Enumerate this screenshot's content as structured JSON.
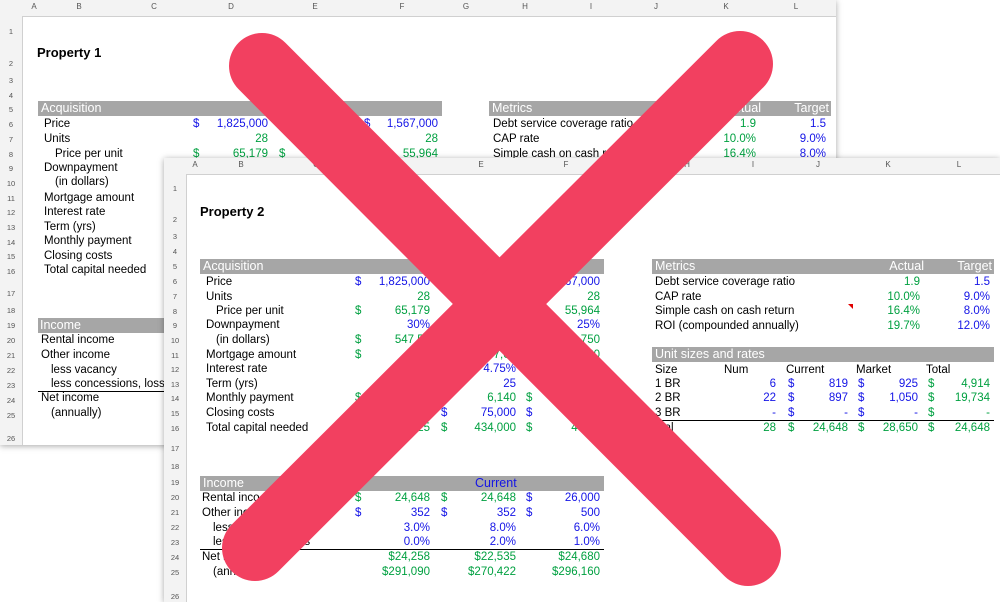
{
  "sheet1": {
    "cols": [
      "A",
      "B",
      "C",
      "D",
      "E",
      "F",
      "G",
      "H",
      "I",
      "J",
      "K",
      "L"
    ],
    "rows": [
      "1",
      "2",
      "3",
      "4",
      "5",
      "6",
      "7",
      "8",
      "9",
      "10",
      "11",
      "12",
      "13",
      "14",
      "15",
      "16",
      "17",
      "18",
      "19",
      "20",
      "21",
      "22",
      "23",
      "24",
      "25",
      "26"
    ],
    "title": "Property 1",
    "acq_header": "Acquisition",
    "acq_labels": [
      "Price",
      "Units",
      "Price per unit",
      "Downpayment",
      "(in dollars)",
      "Mortgage amount",
      "Interest rate",
      "Term (yrs)",
      "Monthly payment",
      "Closing costs",
      "Total capital needed"
    ],
    "price_d": "1,825,000",
    "price_f": "1,567,000",
    "units_d": "28",
    "units_f": "28",
    "ppu_d": "65,179",
    "ppu_f": "55,964",
    "dollar": "$",
    "metrics_header": "Metrics",
    "metrics_actual": "Actual",
    "metrics_target": "Target",
    "metrics": [
      {
        "label": "Debt service coverage ratio",
        "actual": "1.9",
        "target": "1.5"
      },
      {
        "label": "CAP rate",
        "actual": "10.0%",
        "target": "9.0%"
      },
      {
        "label": "Simple cash on cash re",
        "actual": "16.4%",
        "target": "8.0%"
      }
    ],
    "income_header": "Income",
    "income_labels": [
      "Rental income",
      "Other income",
      "less vacancy",
      "less concessions, loss",
      "Net income",
      "(annually)"
    ]
  },
  "sheet2": {
    "cols": [
      "A",
      "B",
      "C",
      "D",
      "E",
      "F",
      "G",
      "H",
      "I",
      "J",
      "K",
      "L"
    ],
    "rows": [
      "1",
      "2",
      "3",
      "4",
      "5",
      "6",
      "7",
      "8",
      "9",
      "10",
      "11",
      "12",
      "13",
      "14",
      "15",
      "16",
      "17",
      "18",
      "19",
      "20",
      "21",
      "22",
      "23",
      "24",
      "25",
      "26"
    ],
    "title": "Property 2",
    "acq_header": "Acquisition",
    "acq": [
      {
        "label": "Price",
        "d": "1,825,000",
        "e": "",
        "f": "1,567,000"
      },
      {
        "label": "Units",
        "d": "28",
        "e": "",
        "f": "28"
      },
      {
        "label": "Price per unit",
        "d": "65,179",
        "e": "",
        "f": "55,964"
      },
      {
        "label": "Downpayment",
        "d": "30%",
        "e": "",
        "f": "25%"
      },
      {
        "label": "(in dollars)",
        "d": "547,50",
        "e": "",
        "f": "1,750"
      },
      {
        "label": "Mortgage amount",
        "d": "1,27",
        "e": "377,00",
        "f": "60"
      },
      {
        "label": "Interest rate",
        "d": "",
        "e": "4.75%",
        "f": ""
      },
      {
        "label": "Term (yrs)",
        "d": "",
        "e": "25",
        "f": ""
      },
      {
        "label": "Monthly payment",
        "d": "",
        "e": "6,140",
        "f": ""
      },
      {
        "label": "Closing costs",
        "d": "25",
        "e": "75,000",
        "f": "7"
      },
      {
        "label": "Total capital needed",
        "d": "2,825",
        "e": "434,000",
        "f": "466,7"
      }
    ],
    "dollar": "$",
    "metrics_header": "Metrics",
    "metrics_actual": "Actual",
    "metrics_target": "Target",
    "metrics": [
      {
        "label": "Debt service coverage ratio",
        "actual": "1.9",
        "target": "1.5"
      },
      {
        "label": "CAP rate",
        "actual": "10.0%",
        "target": "9.0%"
      },
      {
        "label": "Simple cash on cash return",
        "actual": "16.4%",
        "target": "8.0%"
      },
      {
        "label": "ROI (compounded annually)",
        "actual": "19.7%",
        "target": "12.0%"
      }
    ],
    "units_header": "Unit sizes and rates",
    "units_cols": {
      "size": "Size",
      "num": "Num",
      "current": "Current",
      "market": "Market",
      "total": "Total"
    },
    "units": [
      {
        "size": "1 BR",
        "num": "6",
        "current": "819",
        "market": "925",
        "total": "4,914"
      },
      {
        "size": "2 BR",
        "num": "22",
        "current": "897",
        "market": "1,050",
        "total": "19,734"
      },
      {
        "size": "3 BR",
        "num": "-",
        "current": "-",
        "market": "-",
        "total": "-"
      },
      {
        "size": "otal",
        "num": "28",
        "current": "24,648",
        "market": "28,650",
        "total": "24,648"
      }
    ],
    "income_header": "Income",
    "income_current": "Current",
    "income": [
      {
        "label": "Rental inco",
        "d": "24,648",
        "e": "24,648",
        "f": "26,000"
      },
      {
        "label": "Other inc",
        "d": "352",
        "e": "352",
        "f": "500"
      },
      {
        "label": "less",
        "d": "3.0%",
        "e": "8.0%",
        "f": "6.0%"
      },
      {
        "label": "less          s, losses",
        "d": "0.0%",
        "e": "2.0%",
        "f": "1.0%"
      },
      {
        "label": "Net inc",
        "d": "$24,258",
        "e": "$22,535",
        "f": "$24,680"
      },
      {
        "label": "(annually)",
        "d": "$291,090",
        "e": "$270,422",
        "f": "$296,160"
      }
    ]
  },
  "overlay": {
    "icon": "x-mark-icon",
    "color": "#f24060"
  }
}
